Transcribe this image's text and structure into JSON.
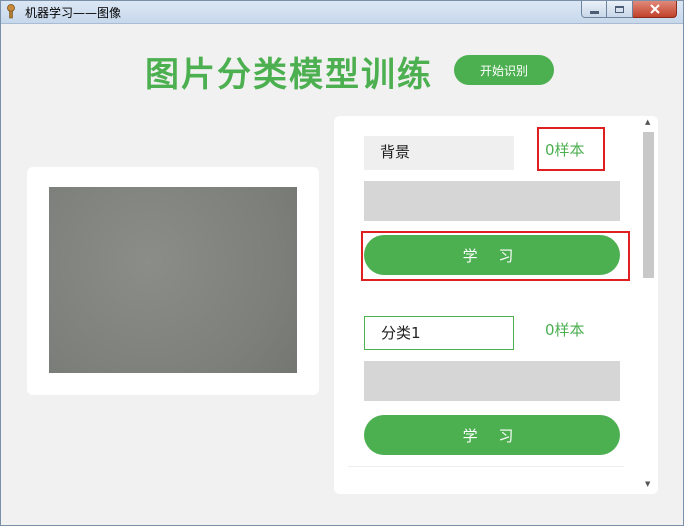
{
  "window": {
    "title": "机器学习——图像",
    "controls": [
      "minimize",
      "maximize",
      "close"
    ]
  },
  "header": {
    "title": "图片分类模型训练",
    "start_button": "开始识别"
  },
  "preview": {
    "image_desc": "camera-preview"
  },
  "classes": [
    {
      "name": "背景",
      "count": "0样本",
      "learn_label": "学 习"
    },
    {
      "name": "分类1",
      "count": "0样本",
      "learn_label": "学 习"
    }
  ],
  "colors": {
    "accent": "#4caf50",
    "highlight": "#e02020",
    "panel": "#ffffff",
    "background": "#f1f1f1",
    "bar": "#d6d6d6"
  }
}
